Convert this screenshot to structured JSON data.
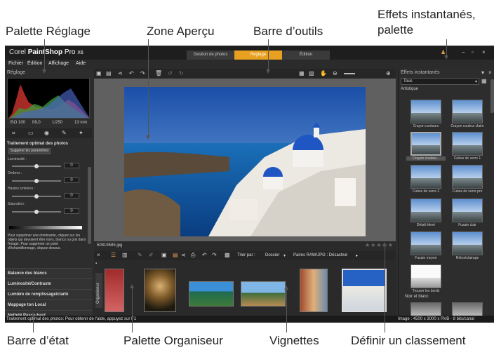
{
  "callouts": {
    "reglage_palette": "Palette Réglage",
    "preview_zone": "Zone Aperçu",
    "toolbar": "Barre d’outils",
    "instant_effects_line1": "Effets instantanés,",
    "instant_effects_line2": "palette",
    "status_bar": "Barre d’état",
    "organizer_palette": "Palette Organiseur",
    "thumbnails": "Vignettes",
    "set_rating": "Définir un classement"
  },
  "app": {
    "logo_corel": "Corel",
    "logo_product": "PaintShop",
    "logo_pro": "Pro",
    "logo_version": "X6",
    "tabs": [
      "Gestion de photos",
      "Réglage",
      "Édition"
    ],
    "active_tab": "Réglage",
    "menu": [
      "Fichier",
      "Édition",
      "Affichage",
      "Aide"
    ]
  },
  "adjust_panel": {
    "title": "Réglage",
    "exif": [
      "ISO 100",
      "f/8,0",
      "1/250",
      "13 mm"
    ],
    "section_title": "Traitement optimal des photos",
    "suggest_button": "Suggérer les paramètres",
    "sliders": [
      {
        "label": "Luminosité :",
        "value": "0",
        "position": 0.5
      },
      {
        "label": "Ombres :",
        "value": "0",
        "position": 0.5
      },
      {
        "label": "Hautes lumières :",
        "value": "0",
        "position": 0.5
      },
      {
        "label": "Saturation :",
        "value": "0",
        "position": 0.5
      }
    ],
    "help_text": "Pour supprimer une dominante, cliquez sur les objets qui devraient être noirs, blancs ou gris dans l'image. Pour supprimer un point d'échantillonnage, cliquez dessus.",
    "sections": [
      "Balance des blancs",
      "Luminosité/Contraste",
      "Lumière de remplissage/clarté",
      "Mappage ton Local",
      "Netteté Passe-haut"
    ]
  },
  "preview": {
    "filename": "50819585.jpg",
    "rating_stars": "★★★★★",
    "rating_value": 0
  },
  "organizer": {
    "sort_label": "Trier par :",
    "sort_value": "Dossier",
    "raw_label": "Paires RAW/JPG : Désactivé",
    "vertical_label": "Organiseur"
  },
  "effects": {
    "title": "Effets instantanés",
    "dropdown": "Tous",
    "category1": "Artistique",
    "thumbs": [
      "Crayon contours",
      "Crayon couleur claire",
      "Crayon couleur...",
      "Cubes de verre 1",
      "Cubes de verre 2",
      "Cubes de verre pro",
      "Détail élevé",
      "Fusain clair",
      "Fusain moyen",
      "Rétroéclairage",
      "Trouver les bords"
    ],
    "category2": "Noir et blanc"
  },
  "status": {
    "left": "Traitement optimal des photos: Pour obtenir de l'aide, appuyez sur F1",
    "right": "Image : 4500 x 3000 x RVB - 8 bits/canal"
  },
  "colors": {
    "active_tab": "#e8a020",
    "panel_bg": "#2d2d2d",
    "preview_bg": "#606060"
  }
}
